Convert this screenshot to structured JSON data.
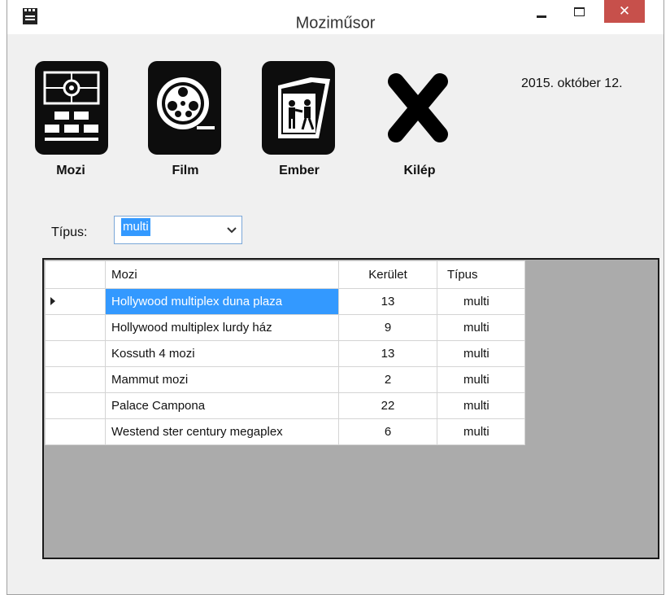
{
  "window": {
    "title": "Moziműsor"
  },
  "toolbar": {
    "buttons": [
      {
        "label": "Mozi",
        "icon": "cinema-screen-icon"
      },
      {
        "label": "Film",
        "icon": "film-reel-icon"
      },
      {
        "label": "Ember",
        "icon": "people-icon"
      },
      {
        "label": "Kilép",
        "icon": "exit-x-icon"
      }
    ]
  },
  "date": "2015. október 12.",
  "filter": {
    "label": "Típus:",
    "value": "multi"
  },
  "table": {
    "columns": [
      "Mozi",
      "Kerület",
      "Típus"
    ],
    "rows": [
      {
        "mozi": "Hollywood multiplex duna plaza",
        "kerulet": "13",
        "tipus": "multi"
      },
      {
        "mozi": "Hollywood multiplex lurdy ház",
        "kerulet": "9",
        "tipus": "multi"
      },
      {
        "mozi": "Kossuth 4 mozi",
        "kerulet": "13",
        "tipus": "multi"
      },
      {
        "mozi": "Mammut mozi",
        "kerulet": "2",
        "tipus": "multi"
      },
      {
        "mozi": "Palace Campona",
        "kerulet": "22",
        "tipus": "multi"
      },
      {
        "mozi": "Westend ster century megaplex",
        "kerulet": "6",
        "tipus": "multi"
      }
    ]
  },
  "colors": {
    "selection": "#3399ff",
    "close_button": "#c7504b",
    "grid_background": "#ababab"
  }
}
